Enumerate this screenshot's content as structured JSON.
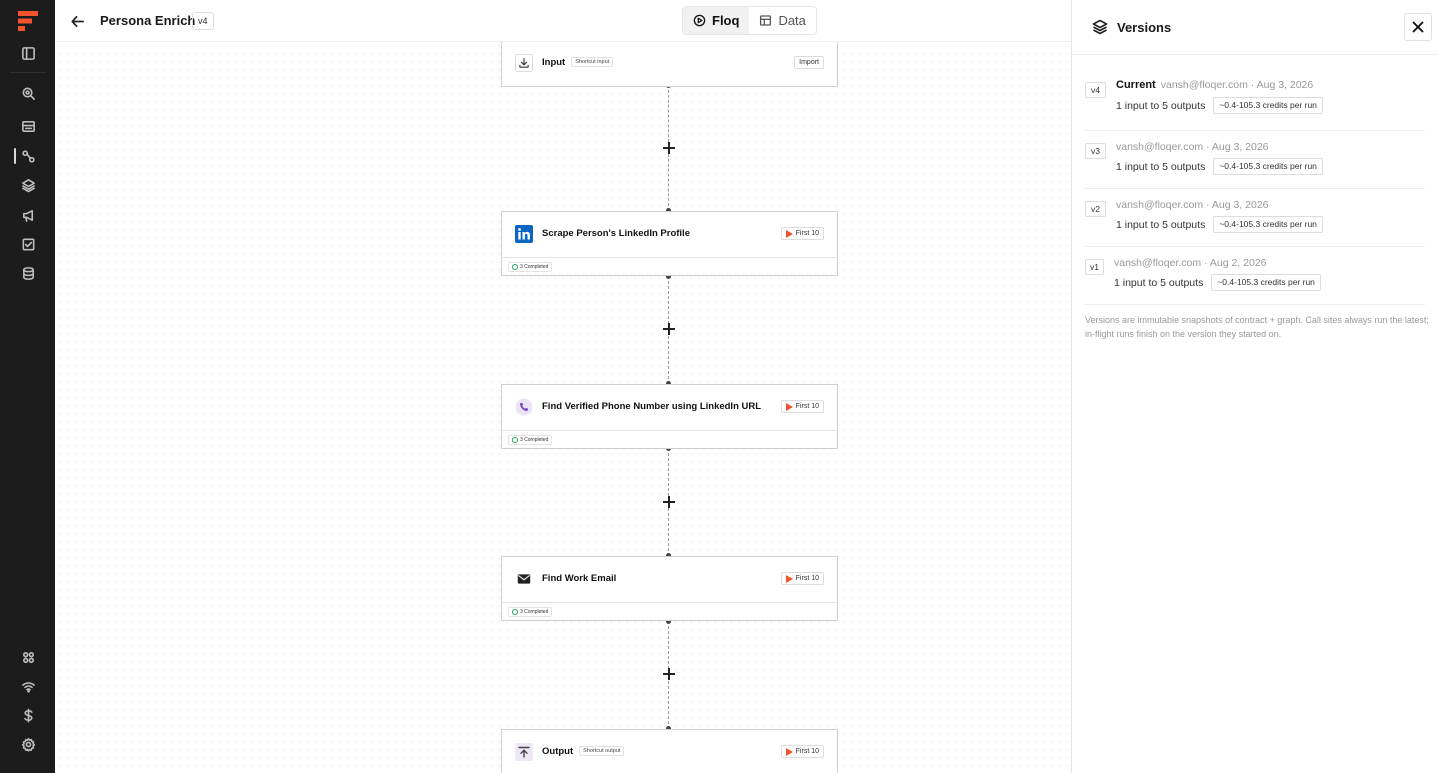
{
  "header": {
    "title": "Persona Enrich",
    "version_badge": "v4",
    "tabs": [
      {
        "label": "Floq",
        "icon": "play-circle-icon",
        "active": true
      },
      {
        "label": "Data",
        "icon": "table-icon",
        "active": false
      }
    ]
  },
  "sidebar": {
    "items": [
      {
        "icon": "sidebar-toggle-icon"
      },
      {
        "icon": "search-icon"
      },
      {
        "icon": "inbox-icon"
      },
      {
        "icon": "workflow-icon",
        "active": true
      },
      {
        "icon": "layers-icon"
      },
      {
        "icon": "megaphone-icon"
      },
      {
        "icon": "checkbox-icon"
      },
      {
        "icon": "database-icon"
      },
      {
        "icon": "apps-icon"
      },
      {
        "icon": "wifi-icon"
      },
      {
        "icon": "dollar-icon"
      },
      {
        "icon": "gear-icon"
      }
    ]
  },
  "nodes": [
    {
      "label": "Input",
      "sub": "Shortcut input",
      "button": "Import",
      "icon": "download-icon",
      "status": ""
    },
    {
      "label": "Scrape Person's LinkedIn Profile",
      "sub": "",
      "button": "First 10",
      "icon": "linkedin-icon",
      "status": "3 Completed"
    },
    {
      "label": "Find Verified Phone Number using LinkedIn URL",
      "sub": "",
      "button": "First 10",
      "icon": "phone-icon",
      "status": "3 Completed"
    },
    {
      "label": "Find Work Email",
      "sub": "",
      "button": "First 10",
      "icon": "mail-icon",
      "status": "3 Completed"
    },
    {
      "label": "Output",
      "sub": "Shortcut output",
      "button": "First 10",
      "icon": "upload-icon",
      "status": ""
    }
  ],
  "panel": {
    "title": "Versions",
    "versions": [
      {
        "tag": "v4",
        "current_label": "Current",
        "meta": "vansh@floqer.com · Aug 3, 2026",
        "io": "1 input to 5 outputs",
        "credits": "~0.4-105.3 credits per run"
      },
      {
        "tag": "v3",
        "current_label": "",
        "meta": "vansh@floqer.com · Aug 3, 2026",
        "io": "1 input to 5 outputs",
        "credits": "~0.4-105.3 credits per run"
      },
      {
        "tag": "v2",
        "current_label": "",
        "meta": "vansh@floqer.com · Aug 3, 2026",
        "io": "1 input to 5 outputs",
        "credits": "~0.4-105.3 credits per run"
      },
      {
        "tag": "v1",
        "current_label": "",
        "meta": "vansh@floqer.com · Aug 2, 2026",
        "io": "1 input to 5 outputs",
        "credits": "~0.4-105.3 credits per run"
      }
    ],
    "note": "Versions are immutable snapshots of contract + graph. Call sites always run the latest; in-flight runs finish on the version they started on."
  },
  "colors": {
    "accent": "#f2542d",
    "linkedin": "#0a66c2",
    "success": "#22a559",
    "rail": "#1c1c1c"
  }
}
